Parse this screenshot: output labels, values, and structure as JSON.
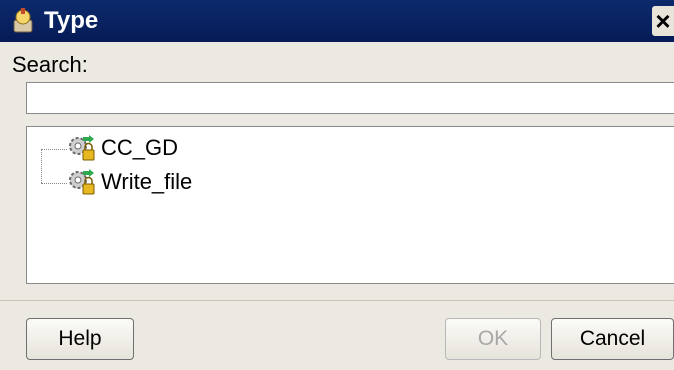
{
  "dialog": {
    "title": "Type",
    "close_label": "×"
  },
  "search": {
    "label": "Search:",
    "value": "",
    "placeholder": ""
  },
  "tree": {
    "items": [
      {
        "label": "CC_GD",
        "icon": "gear-lock-icon"
      },
      {
        "label": "Write_file",
        "icon": "gear-lock-icon"
      }
    ]
  },
  "buttons": {
    "help": "Help",
    "ok": "OK",
    "cancel": "Cancel"
  },
  "colors": {
    "titlebar": "#0c2a6c",
    "dialog_bg": "#ece9e2"
  }
}
